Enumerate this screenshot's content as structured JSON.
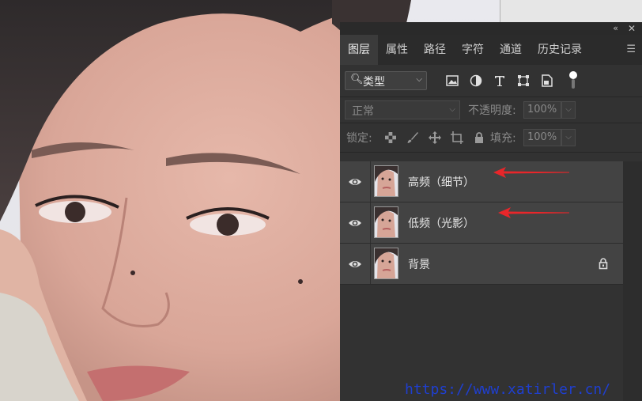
{
  "panel": {
    "tabs": [
      {
        "label": "图层",
        "active": true
      },
      {
        "label": "属性"
      },
      {
        "label": "路径"
      },
      {
        "label": "字符"
      },
      {
        "label": "通道"
      },
      {
        "label": "历史记录"
      }
    ],
    "filter": {
      "label": "类型"
    },
    "blend_mode": "正常",
    "opacity_label": "不透明度:",
    "opacity_value": "100%",
    "lock_label": "锁定:",
    "fill_label": "填充:",
    "fill_value": "100%"
  },
  "layers": [
    {
      "name": "高频（细节）",
      "visible": true,
      "locked": false,
      "annotated": true
    },
    {
      "name": "低频（光影）",
      "visible": true,
      "locked": false,
      "annotated": true
    },
    {
      "name": "背景",
      "visible": true,
      "locked": true,
      "annotated": false
    }
  ],
  "watermark": "https://www.xatirler.cn/",
  "colors": {
    "panel_bg": "#323232",
    "layer_bg": "#434343",
    "arrow": "#e8262a",
    "watermark": "#1f3fd0"
  },
  "icons": [
    "collapse-icon",
    "close-icon",
    "panel-menu-icon",
    "search-icon",
    "image-filter-icon",
    "adjustment-filter-icon",
    "type-filter-icon",
    "shape-filter-icon",
    "smartobject-filter-icon",
    "eye-icon",
    "lock-icon"
  ]
}
